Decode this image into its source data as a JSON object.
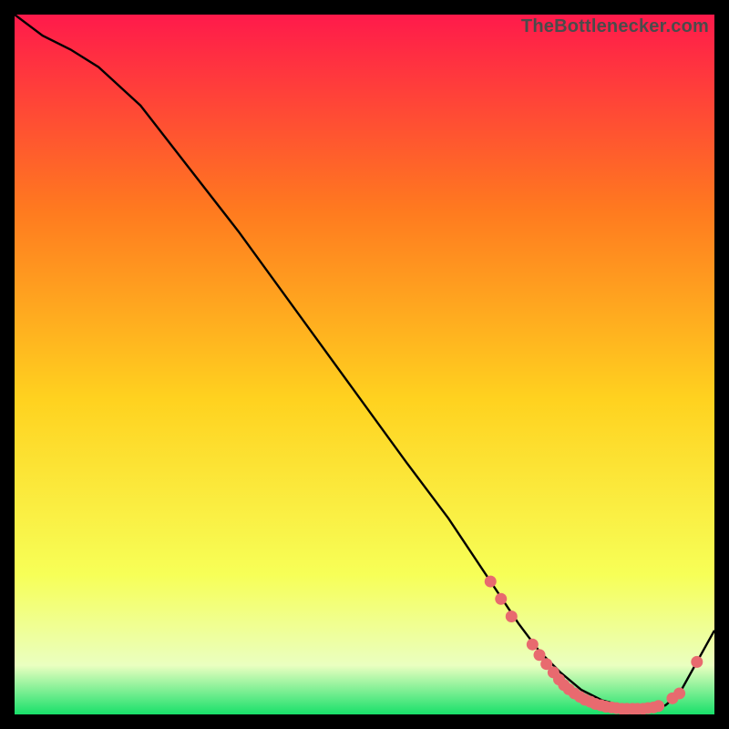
{
  "watermark": "TheBottlenecker.com",
  "colors": {
    "bg": "#000000",
    "curve": "#000000",
    "dot": "#e86a6f",
    "gradient_top": "#ff1a4b",
    "gradient_mid_upper": "#ff7a1f",
    "gradient_mid": "#ffd21f",
    "gradient_mid_lower": "#f7ff57",
    "gradient_near_bottom": "#eaffc0",
    "gradient_bottom": "#18e06a"
  },
  "chart_data": {
    "type": "line",
    "title": "",
    "xlabel": "",
    "ylabel": "",
    "xlim": [
      0,
      100
    ],
    "ylim": [
      0,
      100
    ],
    "curve": {
      "x": [
        0,
        4,
        8,
        12,
        18,
        25,
        32,
        40,
        48,
        56,
        62,
        68,
        72,
        75,
        78,
        81,
        84,
        87,
        89,
        91,
        93,
        95,
        100
      ],
      "y": [
        100,
        97,
        95,
        92.5,
        87,
        78,
        69,
        58,
        47,
        36,
        28,
        19,
        13,
        9,
        6,
        3.5,
        2,
        1.2,
        0.8,
        0.8,
        1.3,
        3,
        12
      ]
    },
    "dots": [
      {
        "x": 68,
        "y": 19
      },
      {
        "x": 69.5,
        "y": 16.5
      },
      {
        "x": 71,
        "y": 14
      },
      {
        "x": 74,
        "y": 10
      },
      {
        "x": 75,
        "y": 8.5
      },
      {
        "x": 76,
        "y": 7.2
      },
      {
        "x": 77,
        "y": 6
      },
      {
        "x": 77.8,
        "y": 5
      },
      {
        "x": 78.5,
        "y": 4.2
      },
      {
        "x": 79.2,
        "y": 3.6
      },
      {
        "x": 80,
        "y": 3
      },
      {
        "x": 80.8,
        "y": 2.5
      },
      {
        "x": 81.5,
        "y": 2.1
      },
      {
        "x": 82.3,
        "y": 1.8
      },
      {
        "x": 83,
        "y": 1.5
      },
      {
        "x": 83.8,
        "y": 1.3
      },
      {
        "x": 84.5,
        "y": 1.1
      },
      {
        "x": 85.3,
        "y": 1.0
      },
      {
        "x": 86,
        "y": 0.9
      },
      {
        "x": 86.8,
        "y": 0.8
      },
      {
        "x": 87.5,
        "y": 0.8
      },
      {
        "x": 88.3,
        "y": 0.8
      },
      {
        "x": 89,
        "y": 0.8
      },
      {
        "x": 89.8,
        "y": 0.8
      },
      {
        "x": 90.5,
        "y": 0.9
      },
      {
        "x": 91.3,
        "y": 1.0
      },
      {
        "x": 92,
        "y": 1.2
      },
      {
        "x": 94,
        "y": 2.3
      },
      {
        "x": 95,
        "y": 3.0
      },
      {
        "x": 97.5,
        "y": 7.5
      }
    ]
  }
}
